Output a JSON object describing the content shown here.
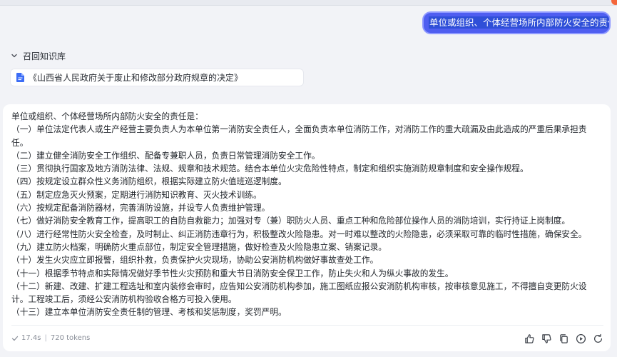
{
  "user_message": {
    "text": "单位或组织、个体经营场所内部防火安全的责任"
  },
  "knowledge_base": {
    "header_label": "召回知识库",
    "documents": [
      {
        "title": "《山西省人民政府关于废止和修改部分政府规章的决定》"
      }
    ]
  },
  "answer": {
    "paragraphs": [
      "单位或组织、个体经营场所内部防火安全的责任是：",
      "（一）单位法定代表人或生产经营主要负责人为本单位第一消防安全责任人，全面负责本单位消防工作，对消防工作的重大疏漏及由此造成的严重后果承担责任。",
      "（二）建立健全消防安全工作组织、配备专兼职人员，负责日常管理消防安全工作。",
      "（三）贯彻执行国家及地方消防法律、法规、规章和技术规范。结合本单位火灾危险性特点，制定和组织实施消防规章制度和安全操作规程。",
      "（四）按规定设立群众性义务消防组织，根据实际建立防火值班巡逻制度。",
      "（五）制定应急灭火预案，定期进行消防知识教育、灭火技术训练。",
      "（六）按规定配备消防器材，完善消防设施，并设专人负责维护管理。",
      "（七）做好消防安全教育工作，提高职工的自防自救能力；加强对专（兼）职防火人员、重点工种和危险部位操作人员的消防培训，实行持证上岗制度。",
      "（八）进行经常性防火安全检查，及时制止、纠正消防违章行为，积极整改火险隐患。对一时难以整改的火险隐患，必须采取可靠的临时性措施，确保安全。",
      "（九）建立防火档案，明确防火重点部位，制定安全管理措施，做好检查及火险隐患立案、销案记录。",
      "（十）发生火灾应立即报警，组织扑救，负责保护火灾现场，协助公安消防机构做好事故查处工作。",
      "（十一）根据季节特点和实际情况做好季节性火灾预防和重大节日消防安全保卫工作，防止失火和人为纵火事故的发生。",
      "（十二）新建、改建、扩建工程选址和室内装修会审时，应告知公安消防机构参加，施工图纸应报公安消防机构审核，按审核意见施工，不得擅自变更防火设计。工程竣工后，须经公安消防机构验收合格方可投入使用。",
      "（十三）建立本单位消防安全责任制的管理、考核和奖惩制度，奖罚严明。"
    ],
    "meta": {
      "duration": "17.4s",
      "tokens": "720 tokens"
    }
  },
  "icons": {
    "kb_toggle": "chevron-down-icon",
    "doc": "document-icon",
    "meta": "check-icon",
    "actions": [
      "thumbs-up-icon",
      "thumbs-down-icon",
      "copy-icon",
      "play-icon",
      "refresh-icon"
    ]
  },
  "colors": {
    "user_bubble": "#4f5ef0",
    "doc_icon": "#3b6cf6",
    "page_bg": "#f2f3f7",
    "notification": "#f4663b"
  }
}
